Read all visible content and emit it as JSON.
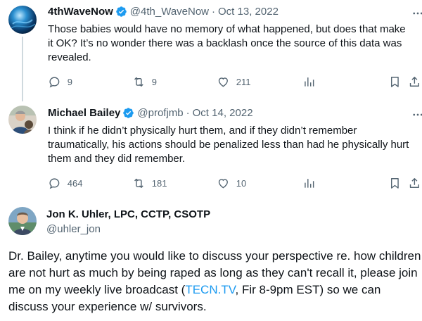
{
  "tweets": [
    {
      "name": "4thWaveNow",
      "handle": "@4th_WaveNow",
      "separator": "·",
      "date": "Oct 13, 2022",
      "text": "Those babies would have no memory of what happened, but does that make it OK? It’s no wonder there was a backlash once the source of this data was revealed.",
      "replies": "9",
      "retweets": "9",
      "likes": "211"
    },
    {
      "name": "Michael Bailey",
      "handle": "@profjmb",
      "separator": "·",
      "date": "Oct 14, 2022",
      "text": "I think if he didn’t physically hurt them, and if they didn’t remember traumatically, his actions should be penalized less than had he physically hurt them and they did remember.",
      "replies": "464",
      "retweets": "181",
      "likes": "10"
    }
  ],
  "main_tweet": {
    "name": "Jon K. Uhler, LPC, CCTP, CSOTP",
    "handle": "@uhler_jon",
    "text_before": "Dr. Bailey, anytime you would like to discuss your perspective re. how children are not hurt as much by being raped as long as they can't recall it, please join me on my weekly live broadcast (",
    "link": "TECN.TV",
    "text_after": ", Fir 8-9pm EST) so we can discuss your experience w/ survivors."
  },
  "colors": {
    "accent": "#1d9bf0",
    "secondary_text": "#536471",
    "primary_text": "#0f1419"
  },
  "icons": [
    "verified-badge-icon",
    "more-options-icon",
    "reply-icon",
    "retweet-icon",
    "like-icon",
    "views-icon",
    "bookmark-icon",
    "share-icon"
  ]
}
